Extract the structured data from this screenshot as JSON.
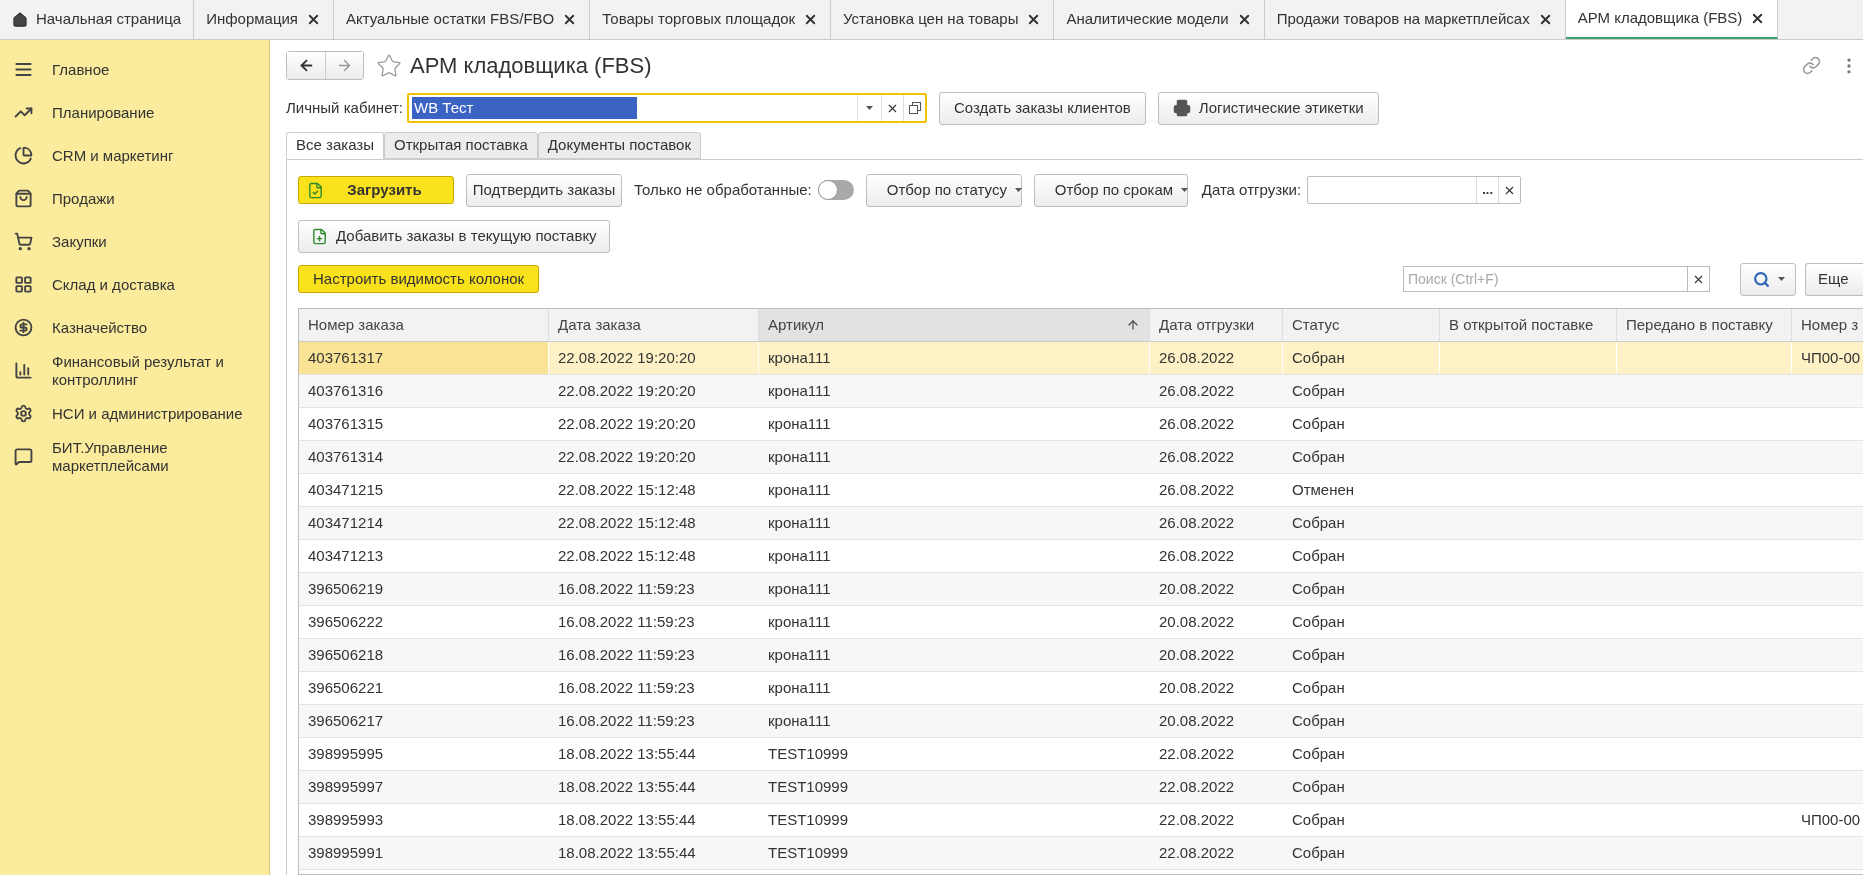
{
  "open_tabs": [
    {
      "kind": "home",
      "label": "Начальная страница",
      "selected": false
    },
    {
      "kind": "document",
      "label": "Информация",
      "selected": false
    },
    {
      "kind": "document",
      "label": "Актуальные остатки FBS/FBO",
      "selected": false
    },
    {
      "kind": "document",
      "label": "Товары торговых площадок",
      "selected": false
    },
    {
      "kind": "document",
      "label": "Установка цен на товары",
      "selected": false
    },
    {
      "kind": "document",
      "label": "Аналитические модели",
      "selected": false
    },
    {
      "kind": "document",
      "label": "Продажи товаров на маркетплейсах",
      "selected": false
    },
    {
      "kind": "document",
      "label": "АРМ кладовщика (FBS)",
      "selected": true
    }
  ],
  "sidebar": {
    "items": [
      {
        "kind": "menu",
        "label": "Главное"
      },
      {
        "kind": "planning",
        "label": "Планирование"
      },
      {
        "kind": "pie",
        "label": "CRM и маркетинг"
      },
      {
        "kind": "bag",
        "label": "Продажи"
      },
      {
        "kind": "cart",
        "label": "Закупки"
      },
      {
        "kind": "grid",
        "label": "Склад и доставка"
      },
      {
        "kind": "ruble",
        "label": "Казначейство"
      },
      {
        "kind": "bars",
        "label": "Финансовый результат и контроллинг"
      },
      {
        "kind": "gear",
        "label": "НСИ и администрирование"
      },
      {
        "kind": "chat",
        "label": "БИТ.Управление маркетплейсами"
      }
    ]
  },
  "page": {
    "title": "АРМ кладовщика (FBS)"
  },
  "account": {
    "label": "Личный кабинет:",
    "value": "WB Тест"
  },
  "header_buttons": [
    {
      "kind": "plain",
      "label": "Создать заказы клиентов"
    },
    {
      "kind": "print",
      "label": "Логистические этикетки"
    }
  ],
  "form_tabs": [
    {
      "label": "Все заказы",
      "selected": true
    },
    {
      "label": "Открытая поставка",
      "selected": false
    },
    {
      "label": "Документы поставок",
      "selected": false
    }
  ],
  "toolbar": {
    "load": "Загрузить",
    "confirm": "Подтвердить заказы",
    "only_unprocessed": {
      "label": "Только не обработанные:",
      "on": false
    },
    "status_filter": "Отбор по статусу",
    "deadline_filter": "Отбор по срокам",
    "ship_date": {
      "label": "Дата отгрузки:",
      "choose": "..."
    },
    "add_to_supply": "Добавить заказы в текущую поставку",
    "columns_button": "Настроить видимость колонок",
    "search": {
      "placeholder": "Поиск (Ctrl+F)"
    },
    "more": "Еще"
  },
  "table": {
    "columns": [
      {
        "label": "Номер заказа",
        "sorted": false
      },
      {
        "label": "Дата заказа",
        "sorted": false
      },
      {
        "label": "Артикул",
        "sorted": true
      },
      {
        "label": "Дата отгрузки",
        "sorted": false
      },
      {
        "label": "Статус",
        "sorted": false
      },
      {
        "label": "В открытой поставке",
        "sorted": false
      },
      {
        "label": "Передано в поставку",
        "sorted": false
      },
      {
        "label": "Номер з",
        "sorted": false
      }
    ],
    "rows": [
      {
        "selected": true,
        "order_number": "403761317",
        "order_date": "22.08.2022 19:20:20",
        "article": "крона111",
        "shipment_date": "26.08.2022",
        "status": "Собран",
        "column_8": "ЧП00-00"
      },
      {
        "selected": false,
        "order_number": "403761316",
        "order_date": "22.08.2022 19:20:20",
        "article": "крона111",
        "shipment_date": "26.08.2022",
        "status": "Собран"
      },
      {
        "selected": false,
        "order_number": "403761315",
        "order_date": "22.08.2022 19:20:20",
        "article": "крона111",
        "shipment_date": "26.08.2022",
        "status": "Собран"
      },
      {
        "selected": false,
        "order_number": "403761314",
        "order_date": "22.08.2022 19:20:20",
        "article": "крона111",
        "shipment_date": "26.08.2022",
        "status": "Собран"
      },
      {
        "selected": false,
        "order_number": "403471215",
        "order_date": "22.08.2022 15:12:48",
        "article": "крона111",
        "shipment_date": "26.08.2022",
        "status": "Отменен"
      },
      {
        "selected": false,
        "order_number": "403471214",
        "order_date": "22.08.2022 15:12:48",
        "article": "крона111",
        "shipment_date": "26.08.2022",
        "status": "Собран"
      },
      {
        "selected": false,
        "order_number": "403471213",
        "order_date": "22.08.2022 15:12:48",
        "article": "крона111",
        "shipment_date": "26.08.2022",
        "status": "Собран"
      },
      {
        "selected": false,
        "order_number": "396506219",
        "order_date": "16.08.2022 11:59:23",
        "article": "крона111",
        "shipment_date": "20.08.2022",
        "status": "Собран"
      },
      {
        "selected": false,
        "order_number": "396506222",
        "order_date": "16.08.2022 11:59:23",
        "article": "крона111",
        "shipment_date": "20.08.2022",
        "status": "Собран"
      },
      {
        "selected": false,
        "order_number": "396506218",
        "order_date": "16.08.2022 11:59:23",
        "article": "крона111",
        "shipment_date": "20.08.2022",
        "status": "Собран"
      },
      {
        "selected": false,
        "order_number": "396506221",
        "order_date": "16.08.2022 11:59:23",
        "article": "крона111",
        "shipment_date": "20.08.2022",
        "status": "Собран"
      },
      {
        "selected": false,
        "order_number": "396506217",
        "order_date": "16.08.2022 11:59:23",
        "article": "крона111",
        "shipment_date": "20.08.2022",
        "status": "Собран"
      },
      {
        "selected": false,
        "order_number": "398995995",
        "order_date": "18.08.2022 13:55:44",
        "article": "TEST10999",
        "shipment_date": "22.08.2022",
        "status": "Собран"
      },
      {
        "selected": false,
        "order_number": "398995997",
        "order_date": "18.08.2022 13:55:44",
        "article": "TEST10999",
        "shipment_date": "22.08.2022",
        "status": "Собран"
      },
      {
        "selected": false,
        "order_number": "398995993",
        "order_date": "18.08.2022 13:55:44",
        "article": "TEST10999",
        "shipment_date": "22.08.2022",
        "status": "Собран",
        "column_8": "ЧП00-00"
      },
      {
        "selected": false,
        "order_number": "398995991",
        "order_date": "18.08.2022 13:55:44",
        "article": "TEST10999",
        "shipment_date": "22.08.2022",
        "status": "Собран"
      }
    ]
  }
}
